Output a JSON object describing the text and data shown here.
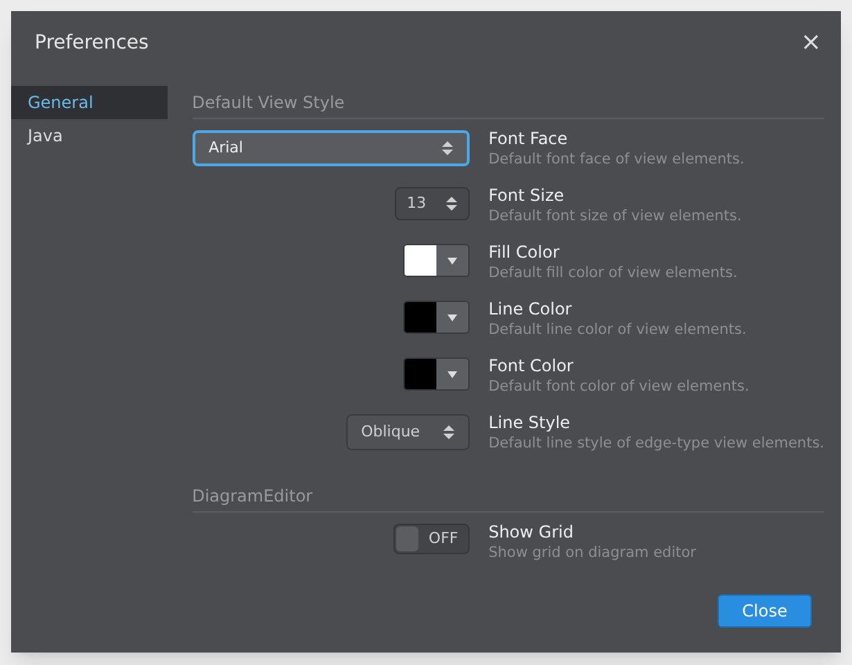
{
  "window": {
    "title": "Preferences",
    "close": "×"
  },
  "sidebar": {
    "items": [
      {
        "label": "General",
        "selected": true
      },
      {
        "label": "Java",
        "selected": false
      }
    ]
  },
  "sections": [
    {
      "title": "Default View Style",
      "settings": [
        {
          "kind": "select",
          "value": "Arial",
          "focused": true,
          "wide": true,
          "label": "Font Face",
          "description": "Default font face of view elements."
        },
        {
          "kind": "spinner",
          "value": "13",
          "label": "Font Size",
          "description": "Default font size of view elements."
        },
        {
          "kind": "color",
          "color": "#ffffff",
          "label": "Fill Color",
          "description": "Default fill color of view elements."
        },
        {
          "kind": "color",
          "color": "#000000",
          "label": "Line Color",
          "description": "Default line color of view elements."
        },
        {
          "kind": "color",
          "color": "#000000",
          "label": "Font Color",
          "description": "Default font color of view elements."
        },
        {
          "kind": "select",
          "value": "Oblique",
          "focused": false,
          "wide": false,
          "label": "Line Style",
          "description": "Default line style of edge-type view elements."
        }
      ]
    },
    {
      "title": "DiagramEditor",
      "settings": [
        {
          "kind": "toggle",
          "on": false,
          "value": "OFF",
          "label": "Show Grid",
          "description": "Show grid on diagram editor"
        }
      ]
    }
  ],
  "buttons": [
    {
      "label": "Close"
    }
  ]
}
